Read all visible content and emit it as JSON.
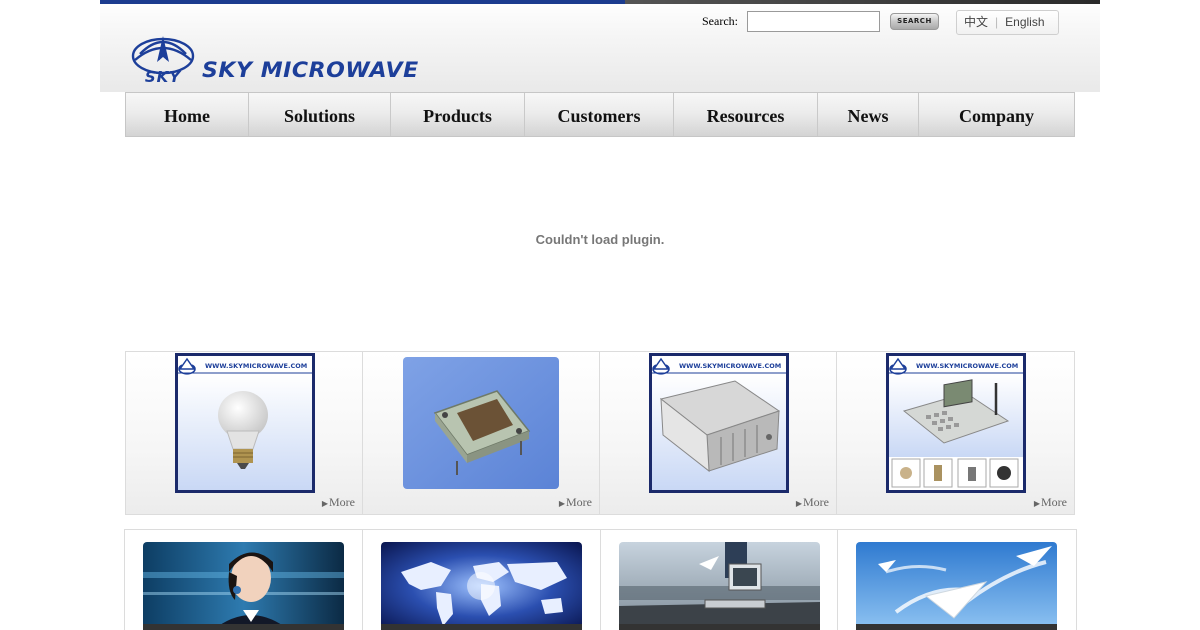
{
  "brand": {
    "name": "SKY MICROWAVE",
    "mark_text": "SKY",
    "colors": {
      "brand_blue": "#1d3f9a",
      "topbar_blue": "#1c3c8f"
    }
  },
  "search": {
    "label": "Search:",
    "value": "",
    "placeholder": "",
    "button_label": "SEARCH"
  },
  "language": {
    "chinese": "中文",
    "english": "English"
  },
  "nav": {
    "items": [
      {
        "label": "Home"
      },
      {
        "label": "Solutions"
      },
      {
        "label": "Products"
      },
      {
        "label": "Customers"
      },
      {
        "label": "Resources"
      },
      {
        "label": "News"
      },
      {
        "label": "Company"
      }
    ]
  },
  "plugin": {
    "message": "Couldn't load plugin."
  },
  "products": {
    "watermark": "WWW.SKYMICROWAVE.COM",
    "items": [
      {
        "icon": "led-bulb-image",
        "more": "More"
      },
      {
        "icon": "microwave-module-image",
        "more": "More"
      },
      {
        "icon": "rf-enclosure-image",
        "more": "More"
      },
      {
        "icon": "desk-phone-image",
        "more": "More"
      }
    ]
  },
  "features": {
    "items": [
      {
        "icon": "support-agent-photo"
      },
      {
        "icon": "world-map-photo"
      },
      {
        "icon": "office-workstation-photo"
      },
      {
        "icon": "paper-planes-photo"
      }
    ]
  }
}
